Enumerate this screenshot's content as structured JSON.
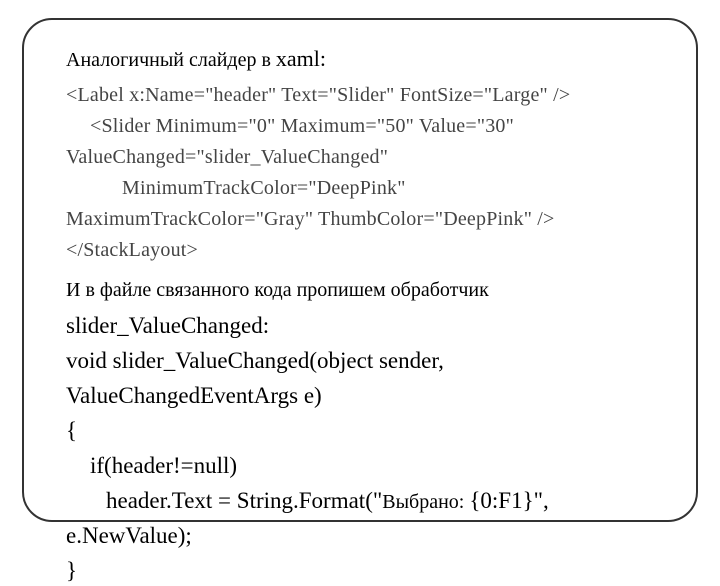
{
  "title": {
    "prefix_rus": "Аналогичный слайдер в ",
    "suffix": "xaml:"
  },
  "xaml": {
    "line1": "<Label x:Name=\"header\" Text=\"Slider\" FontSize=\"Large\" />",
    "line2_a": "<Slider Minimum=\"0\" Maximum=\"50\" Value=\"30\"",
    "line2_b": "ValueChanged=\"slider_ValueChanged\"",
    "line2_c": "MinimumTrackColor=\"DeepPink\"",
    "line2_d": "MaximumTrackColor=\"Gray\" ThumbColor=\"DeepPink\" />",
    "line3": "</StackLayout>"
  },
  "desc": {
    "prefix_rus": "И в файле связанного кода пропишем обработчик",
    "handler_name": "slider_ValueChanged:"
  },
  "code": {
    "sig_a": "void slider_ValueChanged(object sender,",
    "sig_b": "ValueChangedEventArgs e)",
    "brace_open": "{",
    "if_line": "if(header!=null)",
    "assign_a": "header.Text = String.Format(\"",
    "assign_rus": "Выбрано: ",
    "assign_b": "{0:F1}\",",
    "assign_c": "e.NewValue);",
    "brace_close": "}"
  }
}
